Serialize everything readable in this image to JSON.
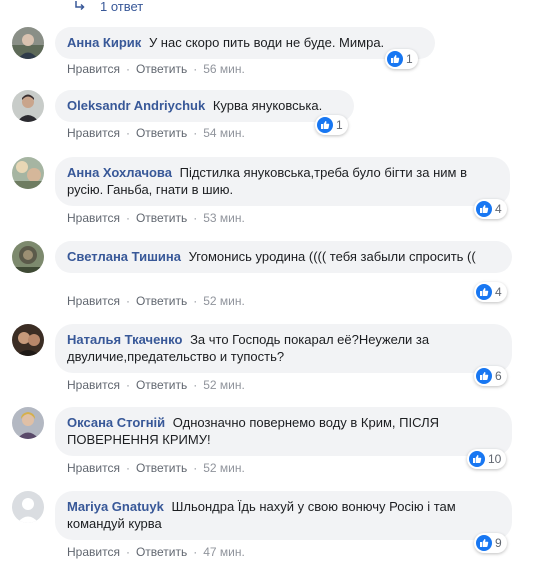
{
  "thread": {
    "replies_label": "1 ответ"
  },
  "labels": {
    "like": "Нравится",
    "reply": "Ответить",
    "separator": "·"
  },
  "colors": {
    "author": "#385898",
    "bubble": "#f2f3f5",
    "like_badge": "#1877f2",
    "meta": "#616770"
  },
  "comments": [
    {
      "author": "Анна Кирик",
      "text": "У нас скоро пить води не буде. Мимра.",
      "time": "56 мин.",
      "likes": "1",
      "avatar_icon": "profile-photo-icon"
    },
    {
      "author": "Oleksandr Andriychuk",
      "text": "Курва януковська.",
      "time": "54 мин.",
      "likes": "1",
      "avatar_icon": "profile-photo-icon"
    },
    {
      "author": "Анна Хохлачова",
      "text": "Підстилка януковська,треба було бігти за ним в русію. Ганьба, гнати в шию.",
      "time": "53 мин.",
      "likes": "4",
      "avatar_icon": "profile-photo-icon"
    },
    {
      "author": "Светлана Тишина",
      "text": "Угомонись уродина (((( тебя забыли спросить ((",
      "time": "52 мин.",
      "likes": "4",
      "avatar_icon": "profile-photo-icon"
    },
    {
      "author": "Наталья Ткаченко",
      "text": "За что Господь покарал её?Неужели за двуличие,предательство и тупость?",
      "time": "52 мин.",
      "likes": "6",
      "avatar_icon": "profile-photo-icon"
    },
    {
      "author": "Оксана Стогній",
      "text": "Однозначно повернемо воду в Крим, ПІСЛЯ ПОВЕРНЕННЯ КРИМУ!",
      "time": "52 мин.",
      "likes": "10",
      "avatar_icon": "profile-photo-icon"
    },
    {
      "author": "Mariya Gnatuyk",
      "text": "Шльондра Їдь нахуй у свою вонючу Росію і там командуй курва",
      "time": "47 мин.",
      "likes": "9",
      "avatar_icon": "default-avatar-icon"
    }
  ]
}
